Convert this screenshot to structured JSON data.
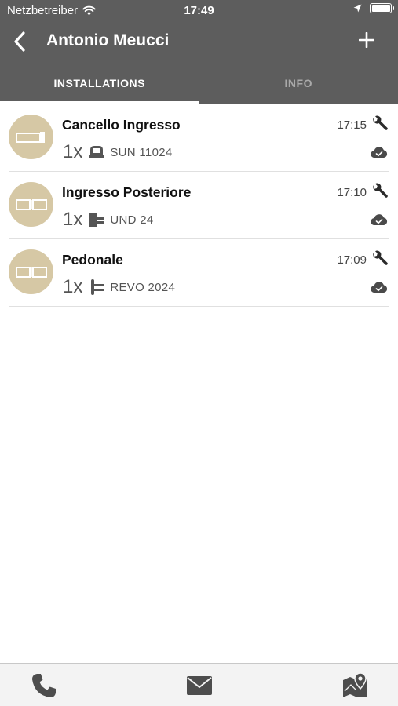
{
  "status_bar": {
    "carrier": "Netzbetreiber",
    "time": "17:49"
  },
  "nav": {
    "title": "Antonio Meucci"
  },
  "tabs": [
    {
      "label": "INSTALLATIONS",
      "active": true
    },
    {
      "label": "INFO",
      "active": false
    }
  ],
  "installations": [
    {
      "title": "Cancello Ingresso",
      "time": "17:15",
      "quantity": "1x",
      "device": "SUN 11024",
      "device_icon": "sun-motor-icon"
    },
    {
      "title": "Ingresso Posteriore",
      "time": "17:10",
      "quantity": "1x",
      "device": "UND 24",
      "device_icon": "underground-motor-icon"
    },
    {
      "title": "Pedonale",
      "time": "17:09",
      "quantity": "1x",
      "device": "REVO 2024",
      "device_icon": "revo-motor-icon"
    }
  ],
  "colors": {
    "header_bg": "#5d5d5d",
    "avatar_bg": "#d6c8a5",
    "toolbar_bg": "#f3f3f3"
  },
  "toolbar": {
    "icons": [
      "phone-icon",
      "mail-icon",
      "map-pin-icon"
    ]
  }
}
